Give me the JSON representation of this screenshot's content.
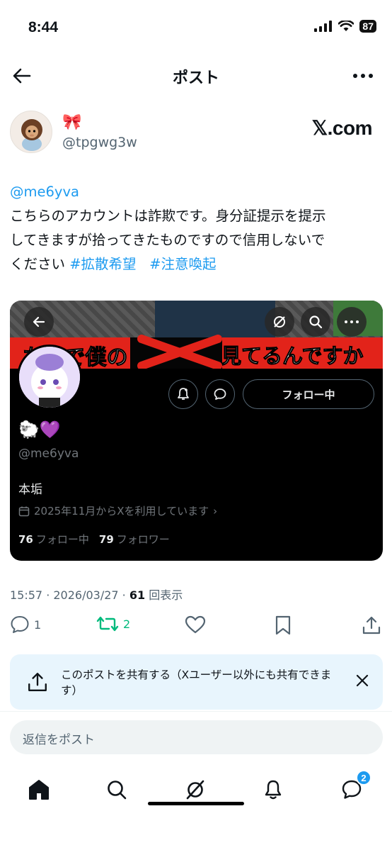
{
  "status_bar": {
    "time": "8:44",
    "battery": "87"
  },
  "header": {
    "title": "ポスト"
  },
  "author": {
    "display_name": "🎀",
    "handle": "@tpgwg3w"
  },
  "source_badge": "𝕏.com",
  "post": {
    "mention": "@me6yva",
    "line1": "こちらのアカウントは詐欺です。身分証提示を提示",
    "line2": "してきますが拾ってきたものですので信用しないで",
    "line3_prefix": "ください ",
    "hashtag1": "#拡散希望",
    "hashtag2": "#注意喚起"
  },
  "embedded_profile": {
    "banner_text_left": "なんで僕の",
    "banner_text_right": "見てるんですか",
    "follow_label": "フォロー中",
    "display_name": "🐑💜",
    "handle": "@me6yva",
    "bio": "本垢",
    "joined": "2025年11月からXを利用しています",
    "following_count": "76",
    "following_label": "フォロー中",
    "followers_count": "79",
    "followers_label": "フォロワー"
  },
  "meta": {
    "time": "15:57",
    "date": "2026/03/27",
    "views": "61",
    "views_label": "回表示"
  },
  "actions": {
    "replies": "1",
    "reposts": "2"
  },
  "share_banner": {
    "text": "このポストを共有する（Xユーザー以外にも共有できます）"
  },
  "reply": {
    "placeholder": "返信をポスト"
  },
  "tabbar": {
    "messages_badge": "2"
  },
  "colors": {
    "accent": "#1d9bf0",
    "repost_green": "#00ba7c",
    "card_bg": "#000000",
    "share_bg": "#e8f5fd"
  }
}
